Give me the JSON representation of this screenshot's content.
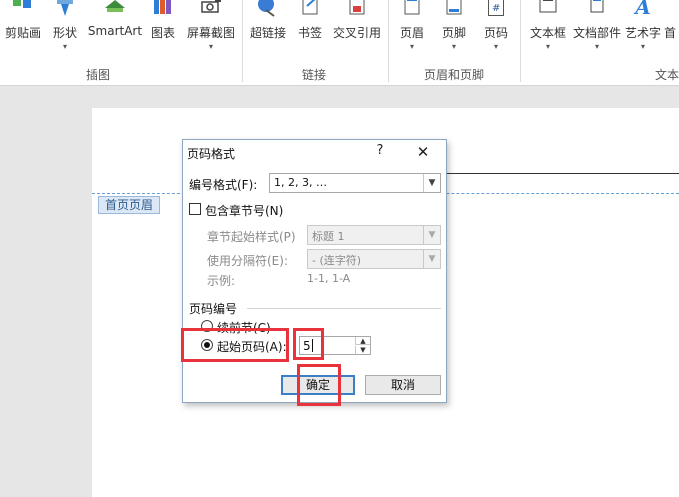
{
  "ribbon": {
    "buttons": [
      {
        "id": "clipart",
        "label": "剪贴画",
        "dropdown": false
      },
      {
        "id": "shapes",
        "label": "形状",
        "dropdown": true
      },
      {
        "id": "smartart",
        "label": "SmartArt",
        "dropdown": false
      },
      {
        "id": "chart",
        "label": "图表",
        "dropdown": false
      },
      {
        "id": "screenshot",
        "label": "屏幕截图",
        "dropdown": true
      },
      {
        "id": "hyperlink",
        "label": "超链接",
        "dropdown": false
      },
      {
        "id": "bookmark",
        "label": "书签",
        "dropdown": false
      },
      {
        "id": "crossref",
        "label": "交叉引用",
        "dropdown": false
      },
      {
        "id": "header",
        "label": "页眉",
        "dropdown": true
      },
      {
        "id": "footer",
        "label": "页脚",
        "dropdown": true
      },
      {
        "id": "pagenum",
        "label": "页码",
        "dropdown": true
      },
      {
        "id": "textbox",
        "label": "文本框",
        "dropdown": true
      },
      {
        "id": "quickparts",
        "label": "文档部件",
        "dropdown": true
      },
      {
        "id": "wordart",
        "label": "艺术字",
        "dropdown": true
      },
      {
        "id": "dropcap",
        "label": "首",
        "dropdown": false
      }
    ],
    "dropdown_glyph": "▾",
    "pagenum_icon_text": "#",
    "wordart_icon_text": "A",
    "groups": {
      "illustrations": "插图",
      "links": "链接",
      "header_footer": "页眉和页脚",
      "text": "文本"
    }
  },
  "document": {
    "header_tag": "首页页眉"
  },
  "dialog": {
    "title": "页码格式",
    "help": "?",
    "close": "✕",
    "number_format_label": "编号格式(F):",
    "number_format_value": "1, 2, 3, …",
    "include_chapter_label": "包含章节号(N)",
    "include_chapter_checked": false,
    "chapter_style_label": "章节起始样式(P)",
    "chapter_style_value": "标题 1",
    "separator_label": "使用分隔符(E):",
    "separator_value": "-  (连字符)",
    "example_label": "示例:",
    "example_value": "1-1, 1-A",
    "page_numbering_label": "页码编号",
    "continue_label": "续前节(C)",
    "start_at_label": "起始页码(A):",
    "start_at_value": "5",
    "selected_option": "start_at",
    "ok_label": "确定",
    "cancel_label": "取消"
  },
  "colors": {
    "highlight": "#e8323c",
    "default_button_border": "#3a7fc8",
    "header_dash": "#6a9fd4"
  }
}
